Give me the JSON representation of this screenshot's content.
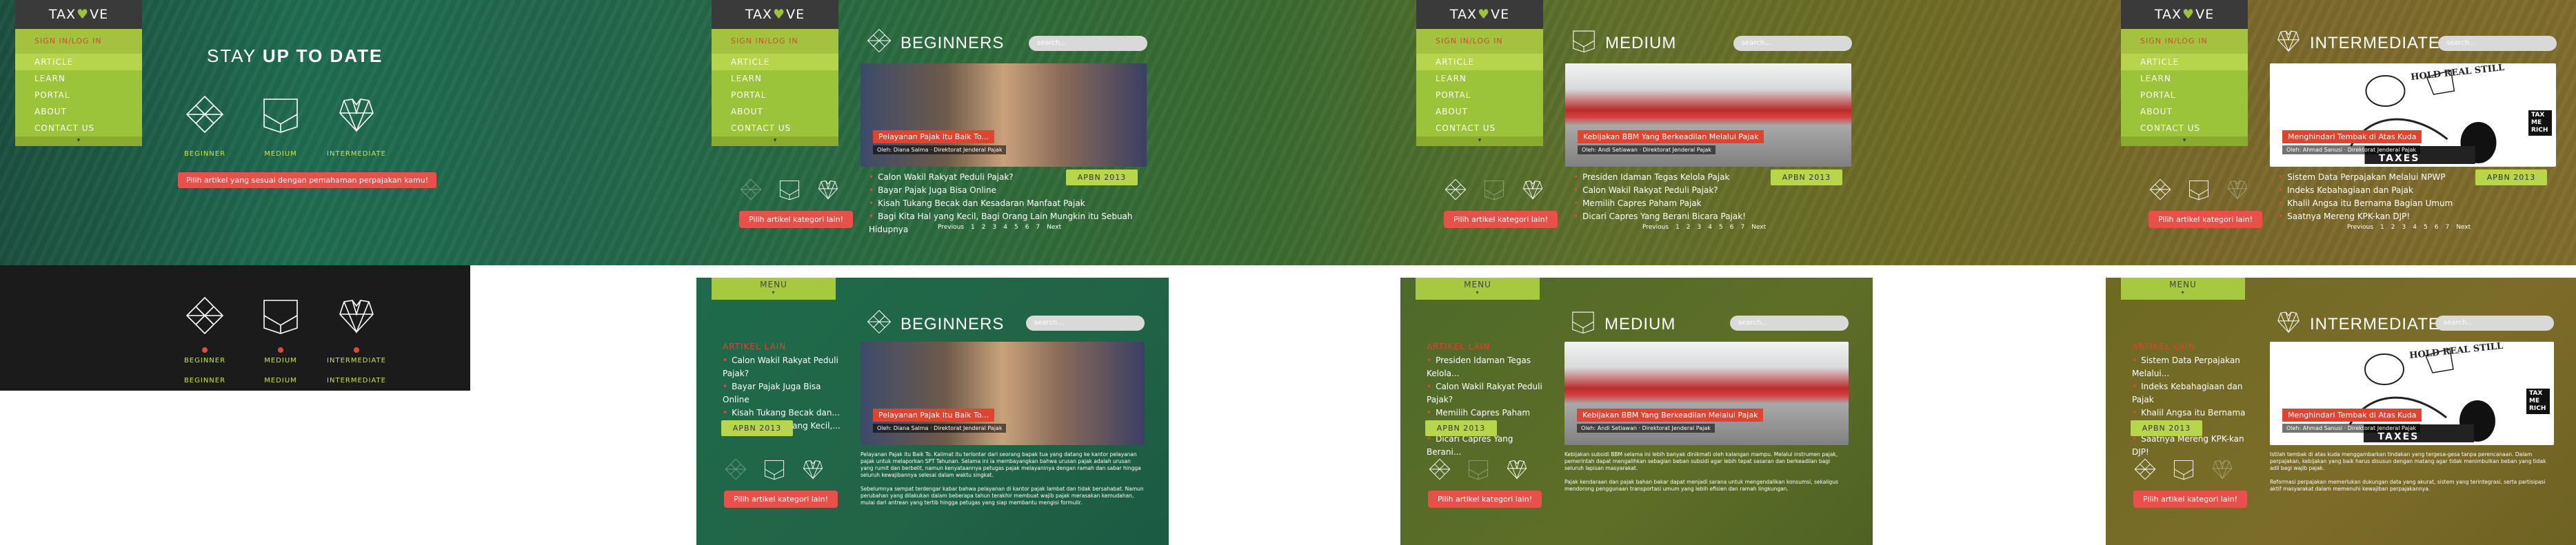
{
  "brand": {
    "logo_text_left": "TAX",
    "logo_heart": "♥",
    "logo_text_right": "VE"
  },
  "menu": {
    "sign_in": "SIGN IN/LOG IN",
    "items": [
      "ARTICLE",
      "LEARN",
      "PORTAL",
      "ABOUT",
      "CONTACT US"
    ],
    "footer": "▾",
    "mobile_label": "MENU",
    "mobile_caret": "▾"
  },
  "landing": {
    "title_light": "STAY",
    "title_bold": "UP TO DATE",
    "tip": "Pilih artikel yang sesuai dengan pemahaman perpajakan kamu!"
  },
  "levels": [
    {
      "label": "BEGINNER",
      "icon": "diamond-icon"
    },
    {
      "label": "MEDIUM",
      "icon": "envelope-icon"
    },
    {
      "label": "INTERMEDIATE",
      "icon": "heart-gem-icon"
    }
  ],
  "search_placeholder": "search...",
  "other_category": "Pilih artikel kategori lain!",
  "apbn": "APBN 2013",
  "artikel_lain": "ARTIKEL LAIN",
  "pager": [
    "Previous",
    "1",
    "2",
    "3",
    "4",
    "5",
    "6",
    "7",
    "Next"
  ],
  "beginner": {
    "title": "BEGINNERS",
    "caption": "Pelayanan Pajak Itu Baik To...",
    "subcaption": "Oleh: Diana Salma · Direktorat Jenderal Pajak",
    "news": [
      "Calon Wakil Rakyat Peduli Pajak?",
      "Bayar Pajak Juga Bisa Online",
      "Kisah Tukang Becak dan Kesadaran Manfaat Pajak",
      "Bagi Kita Hal yang Kecil, Bagi Orang Lain Mungkin itu Sebuah Hidupnya"
    ],
    "news_short": [
      "Calon Wakil Rakyat Peduli Pajak?",
      "Bayar Pajak Juga Bisa Online",
      "Kisah Tukang Becak dan...",
      "Bagi Kita Hal yang Kecil,..."
    ]
  },
  "medium": {
    "title": "MEDIUM",
    "caption": "Kebijakan BBM Yang Berkeadilan Melalui Pajak",
    "subcaption": "Oleh: Andi Setiawan · Direktorat Jenderal Pajak",
    "news": [
      "Presiden Idaman Tegas Kelola Pajak",
      "Calon Wakil Rakyat Peduli Pajak?",
      "Memilih Capres Paham Pajak",
      "Dicari Capres Yang Berani Bicara Pajak!"
    ],
    "news_short": [
      "Presiden Idaman Tegas Kelola...",
      "Calon Wakil Rakyat Peduli Pajak?",
      "Memilih Capres Paham Pajak",
      "Dicari Capres Yang Berani..."
    ]
  },
  "intermediate": {
    "title": "INTERMEDIATE",
    "caption": "Menghindari Tembak di Atas Kuda",
    "subcaption": "Oleh: Ahmad Sanusi · Direktorat Jenderal Pajak",
    "bubble": "HOLD REAL STILL",
    "sign": "TAX ME RICH",
    "taxes": "TAXES",
    "news": [
      "Sistem Data Perpajakan Melalui NPWP",
      "Indeks Kebahagiaan dan Pajak",
      "Khalil Angsa itu Bernama Bagian Umum",
      "Saatnya Mereng KPK-kan DJP!"
    ],
    "news_short": [
      "Sistem Data Perpajakan Melalui...",
      "Indeks Kebahagiaan dan Pajak",
      "Khalil Angsa itu Bernama Bagian...",
      "Saatnya Mereng KPK-kan DJP!"
    ]
  },
  "body_beg": [
    "Pelayanan Pajak itu Baik To. Kalimat itu terlontar dari seorang bapak tua yang datang ke kantor pelayanan pajak untuk melaporkan SPT Tahunan. Selama ini ia membayangkan bahwa urusan pajak adalah urusan yang rumit dan berbelit, namun kenyataannya petugas pajak melayaninya dengan ramah dan sabar hingga seluruh kewajibannya selesai dalam waktu singkat.",
    "Sebelumnya sempat terdengar kabar bahwa pelayanan di kantor pajak lambat dan tidak bersahabat. Namun perubahan yang dilakukan dalam beberapa tahun terakhir membuat wajib pajak merasakan kemudahan, mulai dari antrean yang tertib hingga petugas yang siap membantu mengisi formulir."
  ],
  "body_med": [
    "Kebijakan subsidi BBM selama ini lebih banyak dinikmati oleh kalangan mampu. Melalui instrumen pajak, pemerintah dapat mengalihkan sebagian beban subsidi agar lebih tepat sasaran dan berkeadilan bagi seluruh lapisan masyarakat.",
    "Pajak kendaraan dan pajak bahan bakar dapat menjadi sarana untuk mengendalikan konsumsi, sekaligus mendorong penggunaan transportasi umum yang lebih efisien dan ramah lingkungan."
  ],
  "body_int": [
    "Istilah tembak di atas kuda menggambarkan tindakan yang tergesa-gesa tanpa perencanaan. Dalam perpajakan, kebijakan yang baik harus disusun dengan matang agar tidak menimbulkan beban yang tidak adil bagi wajib pajak.",
    "Reformasi perpajakan memerlukan dukungan data yang akurat, sistem yang terintegrasi, serta partisipasi aktif masyarakat dalam memenuhi kewajiban perpajakannya."
  ],
  "colors": {
    "accent": "#9cc43a",
    "alert": "#e8504a",
    "dark": "#1b1b1b"
  }
}
